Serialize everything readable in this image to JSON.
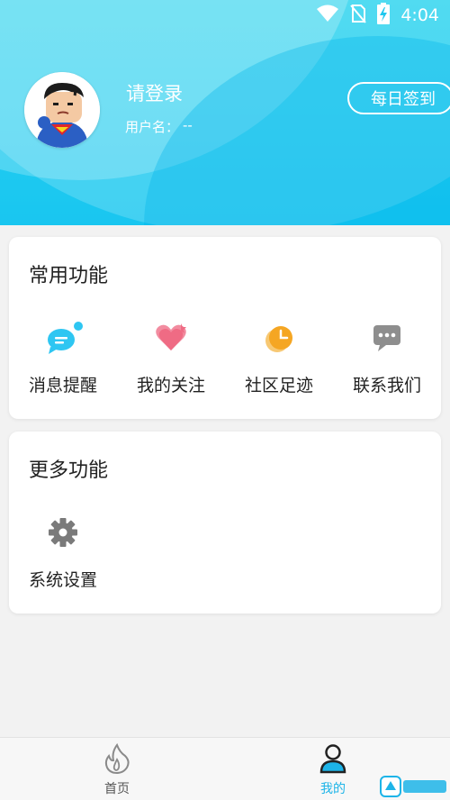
{
  "status_bar": {
    "time": "4:04"
  },
  "profile": {
    "login_text": "请登录",
    "username_label": "用户名：",
    "username_value": "--",
    "checkin_label": "每日签到"
  },
  "common_functions": {
    "title": "常用功能",
    "items": [
      {
        "label": "消息提醒",
        "icon": "message-bubble-icon"
      },
      {
        "label": "我的关注",
        "icon": "heart-icon"
      },
      {
        "label": "社区足迹",
        "icon": "clock-icon"
      },
      {
        "label": "联系我们",
        "icon": "chat-dots-icon"
      }
    ]
  },
  "more_functions": {
    "title": "更多功能",
    "items": [
      {
        "label": "系统设置",
        "icon": "gear-icon"
      }
    ]
  },
  "bottom_nav": {
    "items": [
      {
        "label": "首页",
        "icon": "flame-icon",
        "active": false
      },
      {
        "label": "我的",
        "icon": "user-icon",
        "active": true
      }
    ]
  },
  "colors": {
    "header_gradient_top": "#2bd3ee",
    "header_gradient_bottom": "#19c6f0",
    "accent": "#1db4e8",
    "heart": "#f0657c",
    "clock": "#f5a623",
    "chat": "#8e8e8e"
  }
}
